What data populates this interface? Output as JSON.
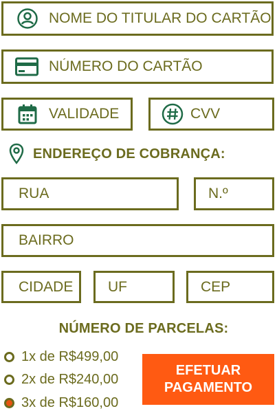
{
  "card_form": {
    "holder_name": {
      "placeholder": "NOME DO TITULAR DO CARTÃO",
      "value": "",
      "icon": "person-circle-icon"
    },
    "card_number": {
      "placeholder": "NÚMERO DO CARTÃO",
      "value": "",
      "icon": "credit-card-icon"
    },
    "expiry": {
      "placeholder": "VALIDADE",
      "value": "",
      "icon": "calendar-icon"
    },
    "cvv": {
      "placeholder": "CVV",
      "value": "",
      "icon": "hash-circle-icon"
    }
  },
  "billing": {
    "title": "ENDEREÇO DE COBRANÇA:",
    "icon": "map-pin-icon",
    "street": {
      "placeholder": "RUA",
      "value": ""
    },
    "number": {
      "placeholder": "N.º",
      "value": ""
    },
    "district": {
      "placeholder": "BAIRRO",
      "value": ""
    },
    "city": {
      "placeholder": "CIDADE",
      "value": ""
    },
    "state": {
      "placeholder": "UF",
      "value": ""
    },
    "zip": {
      "placeholder": "CEP",
      "value": ""
    }
  },
  "installments": {
    "title": "NÚMERO DE PARCELAS:",
    "options": [
      {
        "label": "1x de R$499,00",
        "selected": false
      },
      {
        "label": "2x de R$240,00",
        "selected": false
      },
      {
        "label": "3x de R$160,00",
        "selected": true
      }
    ]
  },
  "pay_button": {
    "label": "EFETUAR PAGAMENTO"
  },
  "colors": {
    "accent": "#6b6b1e",
    "button": "#ff5a12",
    "selected_radio": "#e85410"
  }
}
